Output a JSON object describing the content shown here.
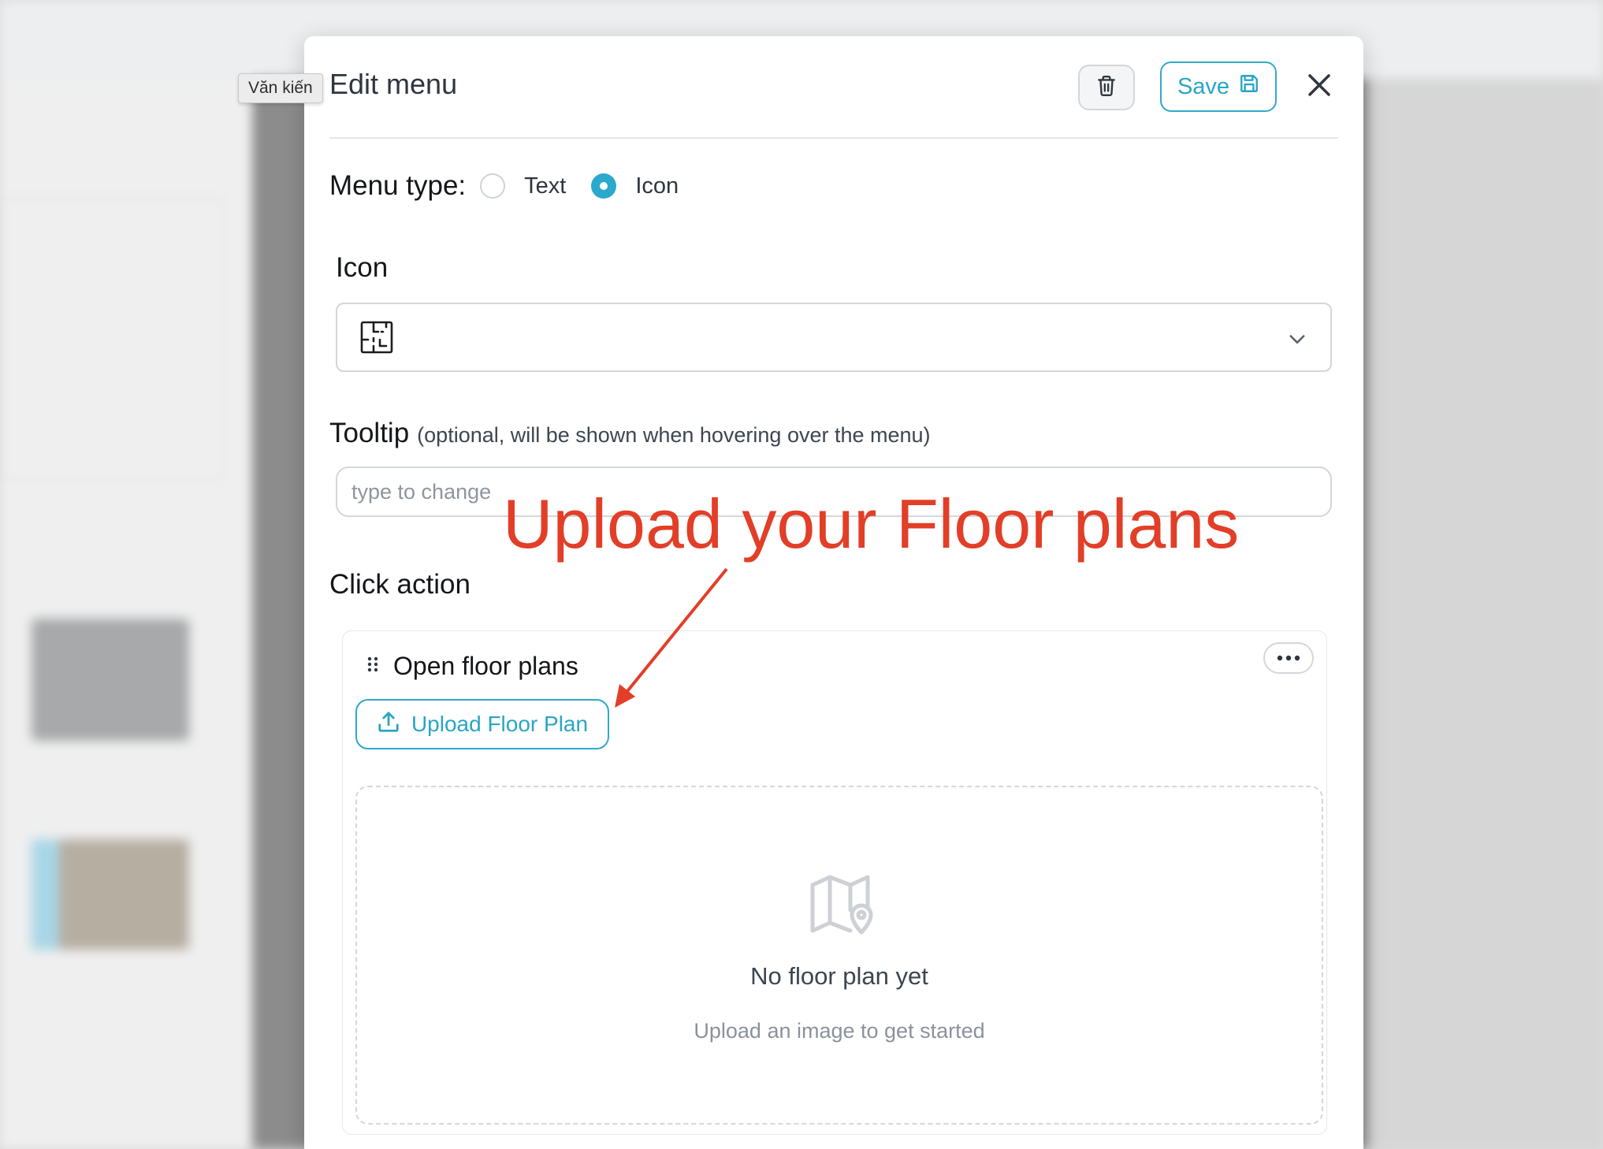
{
  "tooltip_popup": {
    "text": "Văn kiến"
  },
  "modal": {
    "title": "Edit menu",
    "save_label": "Save",
    "menu_type": {
      "label": "Menu type:",
      "options": [
        "Text",
        "Icon"
      ],
      "selected": "Icon"
    },
    "icon_section": {
      "label": "Icon",
      "selected_icon": "floor-plan-icon"
    },
    "tooltip_section": {
      "label": "Tooltip",
      "hint": "(optional, will be shown when hovering over the menu)",
      "placeholder": "type to change",
      "value": ""
    },
    "click_action": {
      "label": "Click action",
      "action_title": "Open floor plans",
      "upload_button_label": "Upload Floor Plan",
      "empty_state": {
        "title": "No floor plan yet",
        "subtitle": "Upload an image to get started",
        "icon": "map-pin-icon"
      }
    }
  },
  "annotation": {
    "text": "Upload your Floor plans",
    "color": "#e23e28"
  },
  "colors": {
    "accent": "#2aa5c5",
    "annotation": "#e23e28"
  }
}
